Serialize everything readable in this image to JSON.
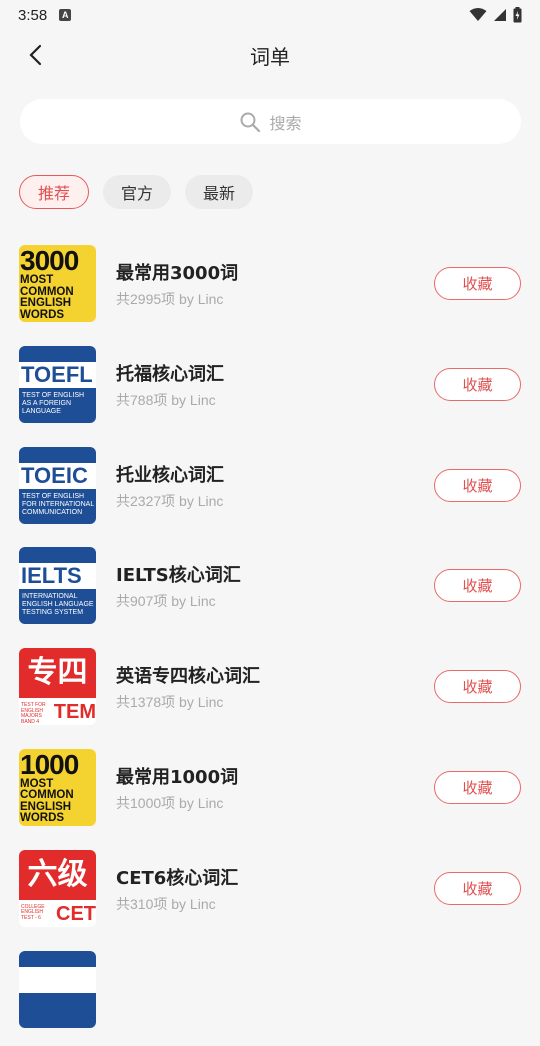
{
  "status": {
    "time": "3:58",
    "a_badge": "A"
  },
  "header": {
    "title": "词单"
  },
  "search": {
    "placeholder": "搜索"
  },
  "filters": [
    {
      "label": "推荐",
      "active": true
    },
    {
      "label": "官方",
      "active": false
    },
    {
      "label": "最新",
      "active": false
    }
  ],
  "colors": {
    "accent": "#e05050",
    "background": "#f6f6f6",
    "chip": "#ebebeb"
  },
  "items": [
    {
      "name": "最常用3000词",
      "meta": "共2995项 by Linc",
      "button": "收藏",
      "cover": {
        "style": "yellow",
        "big": "3000",
        "lines": [
          "MOST",
          "COMMON",
          "ENGLISH",
          "WORDS"
        ]
      }
    },
    {
      "name": "托福核心词汇",
      "meta": "共788项 by Linc",
      "button": "收藏",
      "cover": {
        "style": "blue",
        "big": "TOEFL",
        "lines": [
          "TEST OF ENGLISH",
          "AS A FOREIGN",
          "LANGUAGE"
        ]
      }
    },
    {
      "name": "托业核心词汇",
      "meta": "共2327项 by Linc",
      "button": "收藏",
      "cover": {
        "style": "blue",
        "big": "TOEIC",
        "lines": [
          "TEST OF ENGLISH",
          "FOR INTERNATIONAL",
          "COMMUNICATION"
        ]
      }
    },
    {
      "name": "IELTS核心词汇",
      "meta": "共907项 by Linc",
      "button": "收藏",
      "cover": {
        "style": "blue",
        "big": "IELTS",
        "lines": [
          "INTERNATIONAL",
          "ENGLISH LANGUAGE",
          "TESTING SYSTEM"
        ]
      }
    },
    {
      "name": "英语专四核心词汇",
      "meta": "共1378项 by Linc",
      "button": "收藏",
      "cover": {
        "style": "red",
        "big": "专四",
        "tag": "TEM",
        "lines": [
          "TEST FOR",
          "ENGLISH",
          "MAJORS",
          "BAND 4"
        ]
      }
    },
    {
      "name": "最常用1000词",
      "meta": "共1000项 by Linc",
      "button": "收藏",
      "cover": {
        "style": "yellow",
        "big": "1000",
        "lines": [
          "MOST",
          "COMMON",
          "ENGLISH",
          "WORDS"
        ]
      }
    },
    {
      "name": "CET6核心词汇",
      "meta": "共310项 by Linc",
      "button": "收藏",
      "cover": {
        "style": "red",
        "big": "六级",
        "tag": "CET",
        "lines": [
          "COLLEGE",
          "ENGLISH",
          "TEST - 6"
        ]
      }
    },
    {
      "name": "",
      "meta": "",
      "button": "",
      "cover": {
        "style": "blue",
        "big": "",
        "lines": []
      }
    }
  ]
}
